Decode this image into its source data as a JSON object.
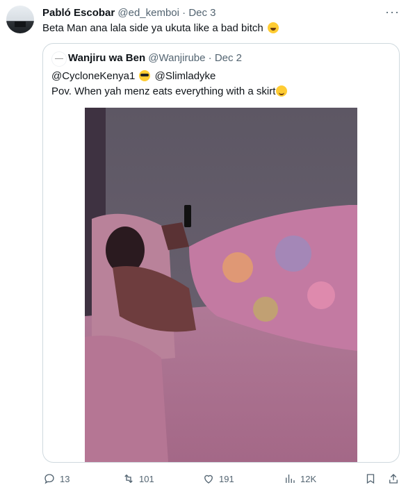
{
  "tweet": {
    "author_name": "Pabló Escobar",
    "handle": "@ed_kemboi",
    "separator": "·",
    "date": "Dec 3",
    "text": "Beta Man ana lala side ya ukuta like a bad bitch",
    "more_icon": "more-icon"
  },
  "quote": {
    "author_name": "Wanjiru wa Ben",
    "handle": "@Wanjirube",
    "separator": "·",
    "date": "Dec 2",
    "mention1": "@CycloneKenya1",
    "mention2": "@Slimladyke",
    "line2": "Pov. When yah menz eats everything with a skirt"
  },
  "actions": {
    "replies": "13",
    "retweets": "101",
    "likes": "191",
    "views": "12K"
  },
  "colors": {
    "text": "#0f1419",
    "secondary": "#536471",
    "border": "#cfd9de"
  }
}
